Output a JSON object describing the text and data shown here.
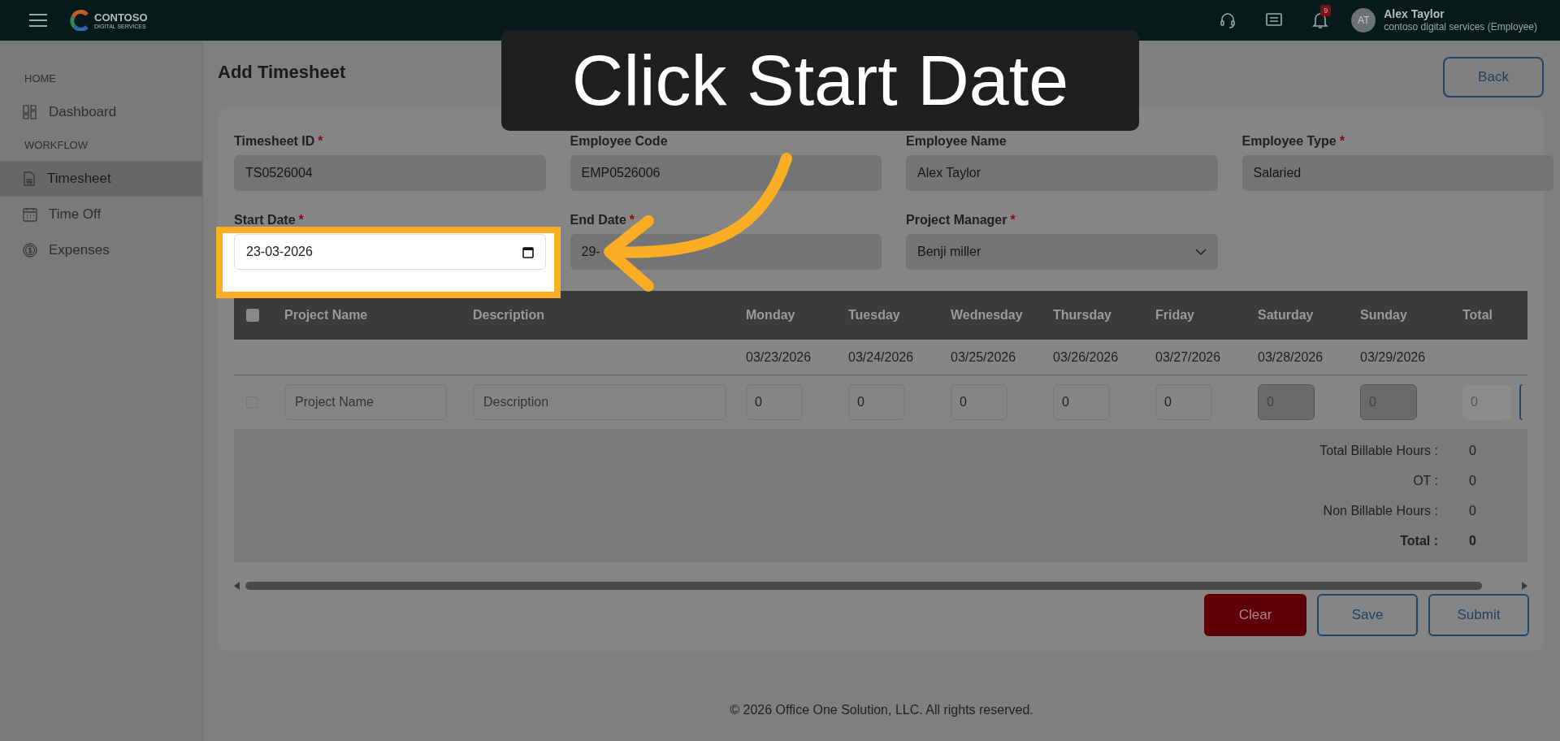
{
  "topbar": {
    "logo": {
      "name": "CONTOSO",
      "tagline": "DIGITAL SERVICES"
    },
    "notifications": "9",
    "user": {
      "initials": "AT",
      "name": "Alex Taylor",
      "role": "contoso digital services (Employee)"
    }
  },
  "sidebar": [
    {
      "kind": "heading",
      "label": "HOME"
    },
    {
      "kind": "item",
      "label": "Dashboard",
      "selected": false
    },
    {
      "kind": "heading",
      "label": "WORKFLOW"
    },
    {
      "kind": "item",
      "label": "Timesheet",
      "selected": true
    },
    {
      "kind": "item",
      "label": "Time Off",
      "selected": false
    },
    {
      "kind": "item",
      "label": "Expenses",
      "selected": false
    }
  ],
  "page": {
    "title": "Add Timesheet",
    "back": "Back"
  },
  "fields": [
    {
      "label": "Timesheet ID",
      "required_mark": "*",
      "value": "TS0526004",
      "kind": "text"
    },
    {
      "label": "Employee Code",
      "value": "EMP0526006",
      "kind": "text"
    },
    {
      "label": "Employee Name",
      "value": "Alex Taylor",
      "kind": "text"
    },
    {
      "label": "Employee Type",
      "required_mark": "*",
      "value": "Salaried",
      "kind": "text"
    },
    {
      "label": "Start Date",
      "required_mark": "*",
      "value": "23-03-2026",
      "kind": "date",
      "highlighted": true
    },
    {
      "label": "End Date",
      "required_mark": "*",
      "value": "29-",
      "kind": "text"
    },
    {
      "label": "Project Manager",
      "required_mark": "*",
      "value": "Benji miller",
      "kind": "select"
    }
  ],
  "table": {
    "all_checked": false,
    "columns": [
      "Project Name",
      "Description"
    ],
    "days": [
      {
        "name": "Monday",
        "date": "03/23/2026",
        "value": "0",
        "disabled": false
      },
      {
        "name": "Tuesday",
        "date": "03/24/2026",
        "value": "0",
        "disabled": false
      },
      {
        "name": "Wednesday",
        "date": "03/25/2026",
        "value": "0",
        "disabled": false
      },
      {
        "name": "Thursday",
        "date": "03/26/2026",
        "value": "0",
        "disabled": false
      },
      {
        "name": "Friday",
        "date": "03/27/2026",
        "value": "0",
        "disabled": false
      },
      {
        "name": "Saturday",
        "date": "03/28/2026",
        "value": "0",
        "disabled": true
      },
      {
        "name": "Sunday",
        "date": "03/29/2026",
        "value": "0",
        "disabled": true
      }
    ],
    "total_column": "Total",
    "row": {
      "checked": false,
      "project_placeholder": "Project Name",
      "description_placeholder": "Description",
      "total": "0"
    },
    "summary": [
      {
        "label": "Total Billable Hours :",
        "value": "0",
        "bold": false
      },
      {
        "label": "OT :",
        "value": "0",
        "bold": false
      },
      {
        "label": "Non Billable Hours :",
        "value": "0",
        "bold": false
      },
      {
        "label": "Total :",
        "value": "0",
        "bold": true
      }
    ]
  },
  "buttons": [
    {
      "kind": "danger",
      "label": "Clear"
    },
    {
      "kind": "outline",
      "label": "Save"
    },
    {
      "kind": "outline",
      "label": "Submit"
    }
  ],
  "footer": "© 2026 Office One Solution, LLC. All rights reserved.",
  "callout": {
    "text": "Click Start Date"
  }
}
